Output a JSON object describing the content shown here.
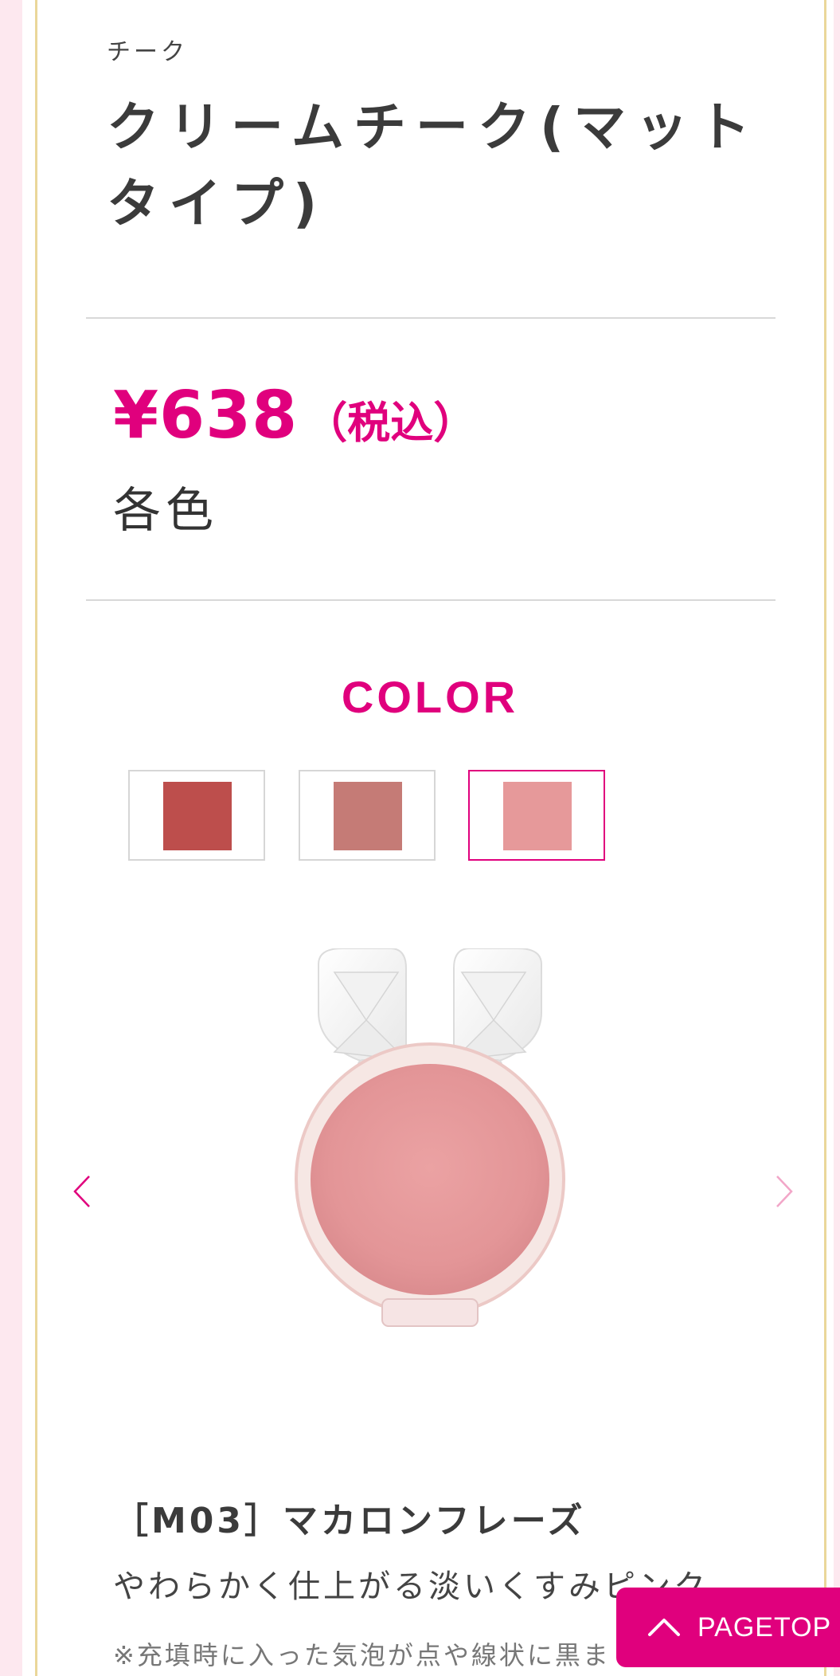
{
  "product": {
    "category": "チーク",
    "title": "クリームチーク(マットタイプ)",
    "price": "¥638",
    "tax_note": "（税込）",
    "variants": "各色"
  },
  "color_section": {
    "heading": "COLOR",
    "swatches": [
      {
        "color": "#bd4e4c",
        "selected": false
      },
      {
        "color": "#c57b76",
        "selected": false
      },
      {
        "color": "#e6999a",
        "selected": true
      }
    ]
  },
  "carousel": {
    "prev_icon": "chevron-left-icon",
    "next_icon": "chevron-right-icon"
  },
  "shade": {
    "name": "［M03］マカロンフレーズ",
    "description": "やわらかく仕上がる淡いくすみピンク",
    "notice": "※充填時に入った気泡が点や線状に黒ま"
  },
  "pagetop": {
    "label": "PAGETOP",
    "icon": "chevron-up-icon"
  },
  "colors": {
    "accent": "#e0007d",
    "gold_border": "#ead79a",
    "page_pink": "#fde8ef"
  }
}
